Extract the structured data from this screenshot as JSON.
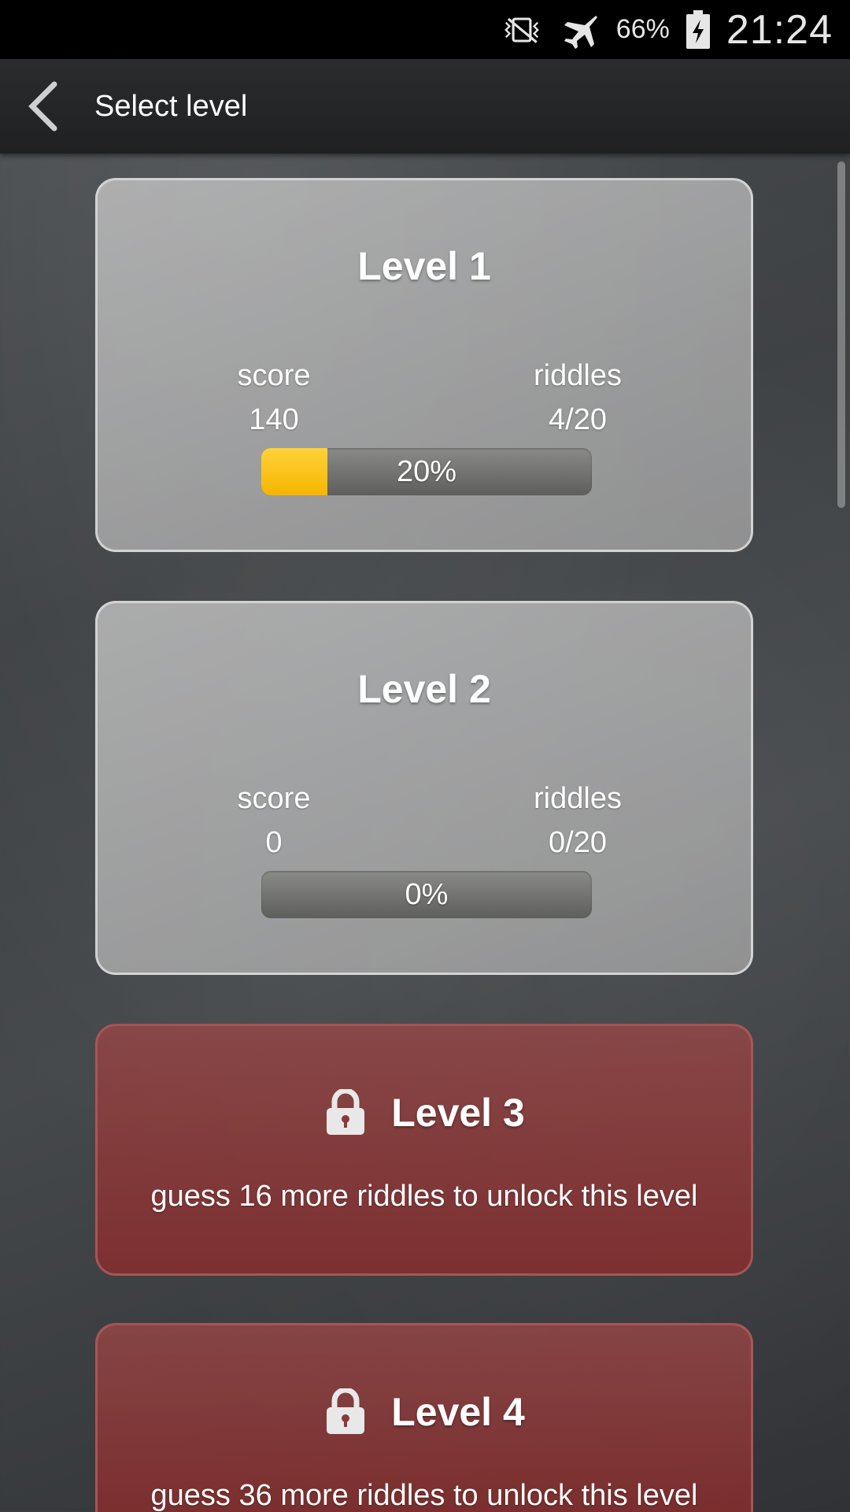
{
  "status_bar": {
    "icons": [
      "vibrate-mute-icon",
      "airplane-icon",
      "battery-charging-icon"
    ],
    "battery": "66%",
    "time": "21:24"
  },
  "app_bar": {
    "back_icon": "chevron-left-icon",
    "title": "Select level"
  },
  "levels": [
    {
      "title": "Level 1",
      "locked": false,
      "score_label": "score",
      "score": "140",
      "riddles_label": "riddles",
      "riddles": "4/20",
      "progress_text": "20%",
      "progress_value": 0.2
    },
    {
      "title": "Level 2",
      "locked": false,
      "score_label": "score",
      "score": "0",
      "riddles_label": "riddles",
      "riddles": "0/20",
      "progress_text": "0%",
      "progress_value": 0
    },
    {
      "title": "Level 3",
      "locked": true,
      "message": "guess 16 more riddles to unlock this level"
    },
    {
      "title": "Level 4",
      "locked": true,
      "message": "guess 36 more riddles to unlock this level"
    }
  ],
  "colors": {
    "progress_fill": "#f7b500",
    "locked_card": "#8a3a3a",
    "unlocked_card": "#b4b4b4"
  }
}
